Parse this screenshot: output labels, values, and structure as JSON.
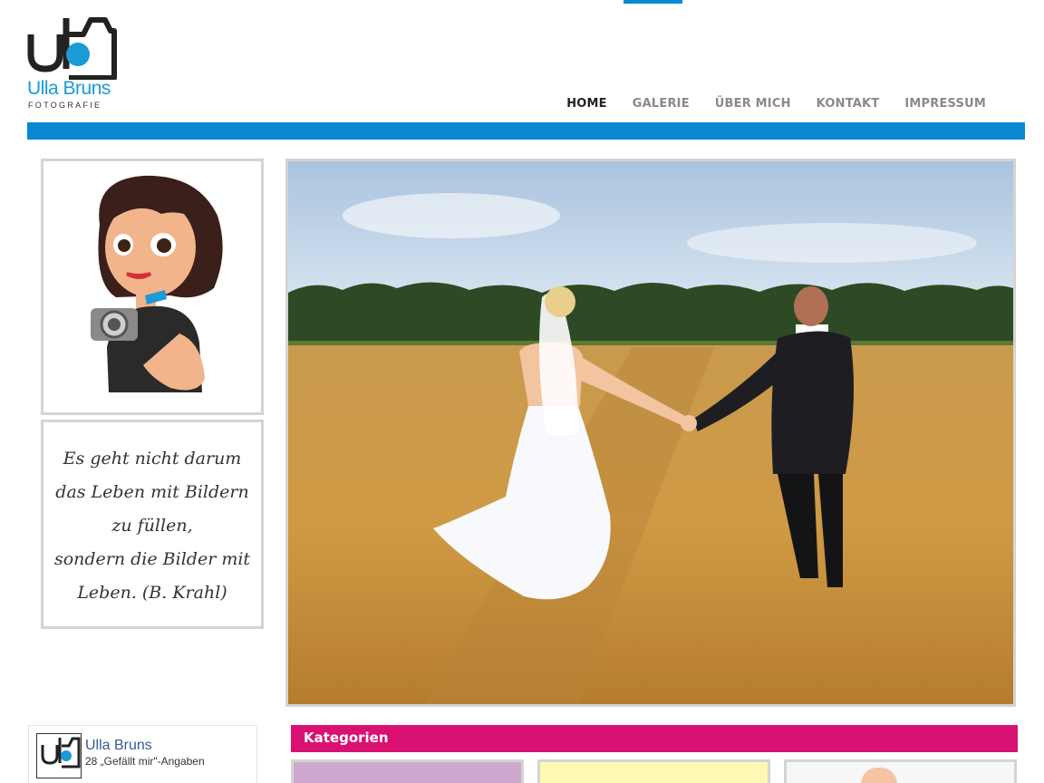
{
  "brand": {
    "logo_monogram": "ub",
    "name": "Ulla Bruns",
    "subtitle": "FOTOGRAFIE"
  },
  "nav": {
    "items": [
      {
        "label": "HOME",
        "active": true
      },
      {
        "label": "GALERIE",
        "active": false
      },
      {
        "label": "ÜBER MICH",
        "active": false
      },
      {
        "label": "KONTAKT",
        "active": false
      },
      {
        "label": "IMPRESSUM",
        "active": false
      }
    ]
  },
  "sidebar": {
    "avatar_icon": "photographer-woman-illustration",
    "quote_lines": [
      "Es geht nicht  darum",
      "das Leben mit Bildern",
      "zu füllen,",
      "sondern die Bilder mit",
      "Leben. (B. Krahl)"
    ]
  },
  "hero": {
    "image": "wedding-couple-wheat-field"
  },
  "facebook": {
    "page_name": "Ulla Bruns",
    "likes_text": "28 „Gefällt mir\"-Angaben"
  },
  "categories": {
    "title": "Kategorien"
  },
  "colors": {
    "accent_blue": "#0a88d4",
    "category_pink": "#d91172",
    "nav_active": "#222222",
    "nav_inactive": "#8a8a8a"
  }
}
